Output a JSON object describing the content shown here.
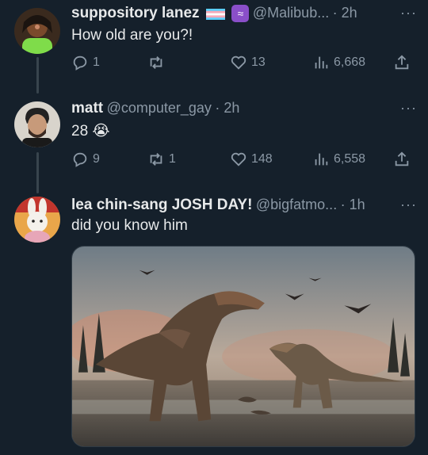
{
  "tweets": [
    {
      "name": "suppository lanez",
      "handle": "@Malibub...",
      "time": "· 2h",
      "text": "How old are you?!",
      "replies": "1",
      "retweets": "",
      "likes": "13",
      "views": "6,668"
    },
    {
      "name": "matt",
      "handle": "@computer_gay",
      "time": "· 2h",
      "text": "28",
      "emoji": "😭",
      "replies": "9",
      "retweets": "1",
      "likes": "148",
      "views": "6,558"
    },
    {
      "name": "lea chin-sang JOSH DAY!",
      "handle": "@bigfatmo...",
      "time": "· 1h",
      "text": "did you know him"
    }
  ],
  "more_label": "···",
  "colors": {
    "background": "#15202b",
    "text": "#e7e9ea",
    "muted": "#8b98a5",
    "thread": "#38444d"
  }
}
